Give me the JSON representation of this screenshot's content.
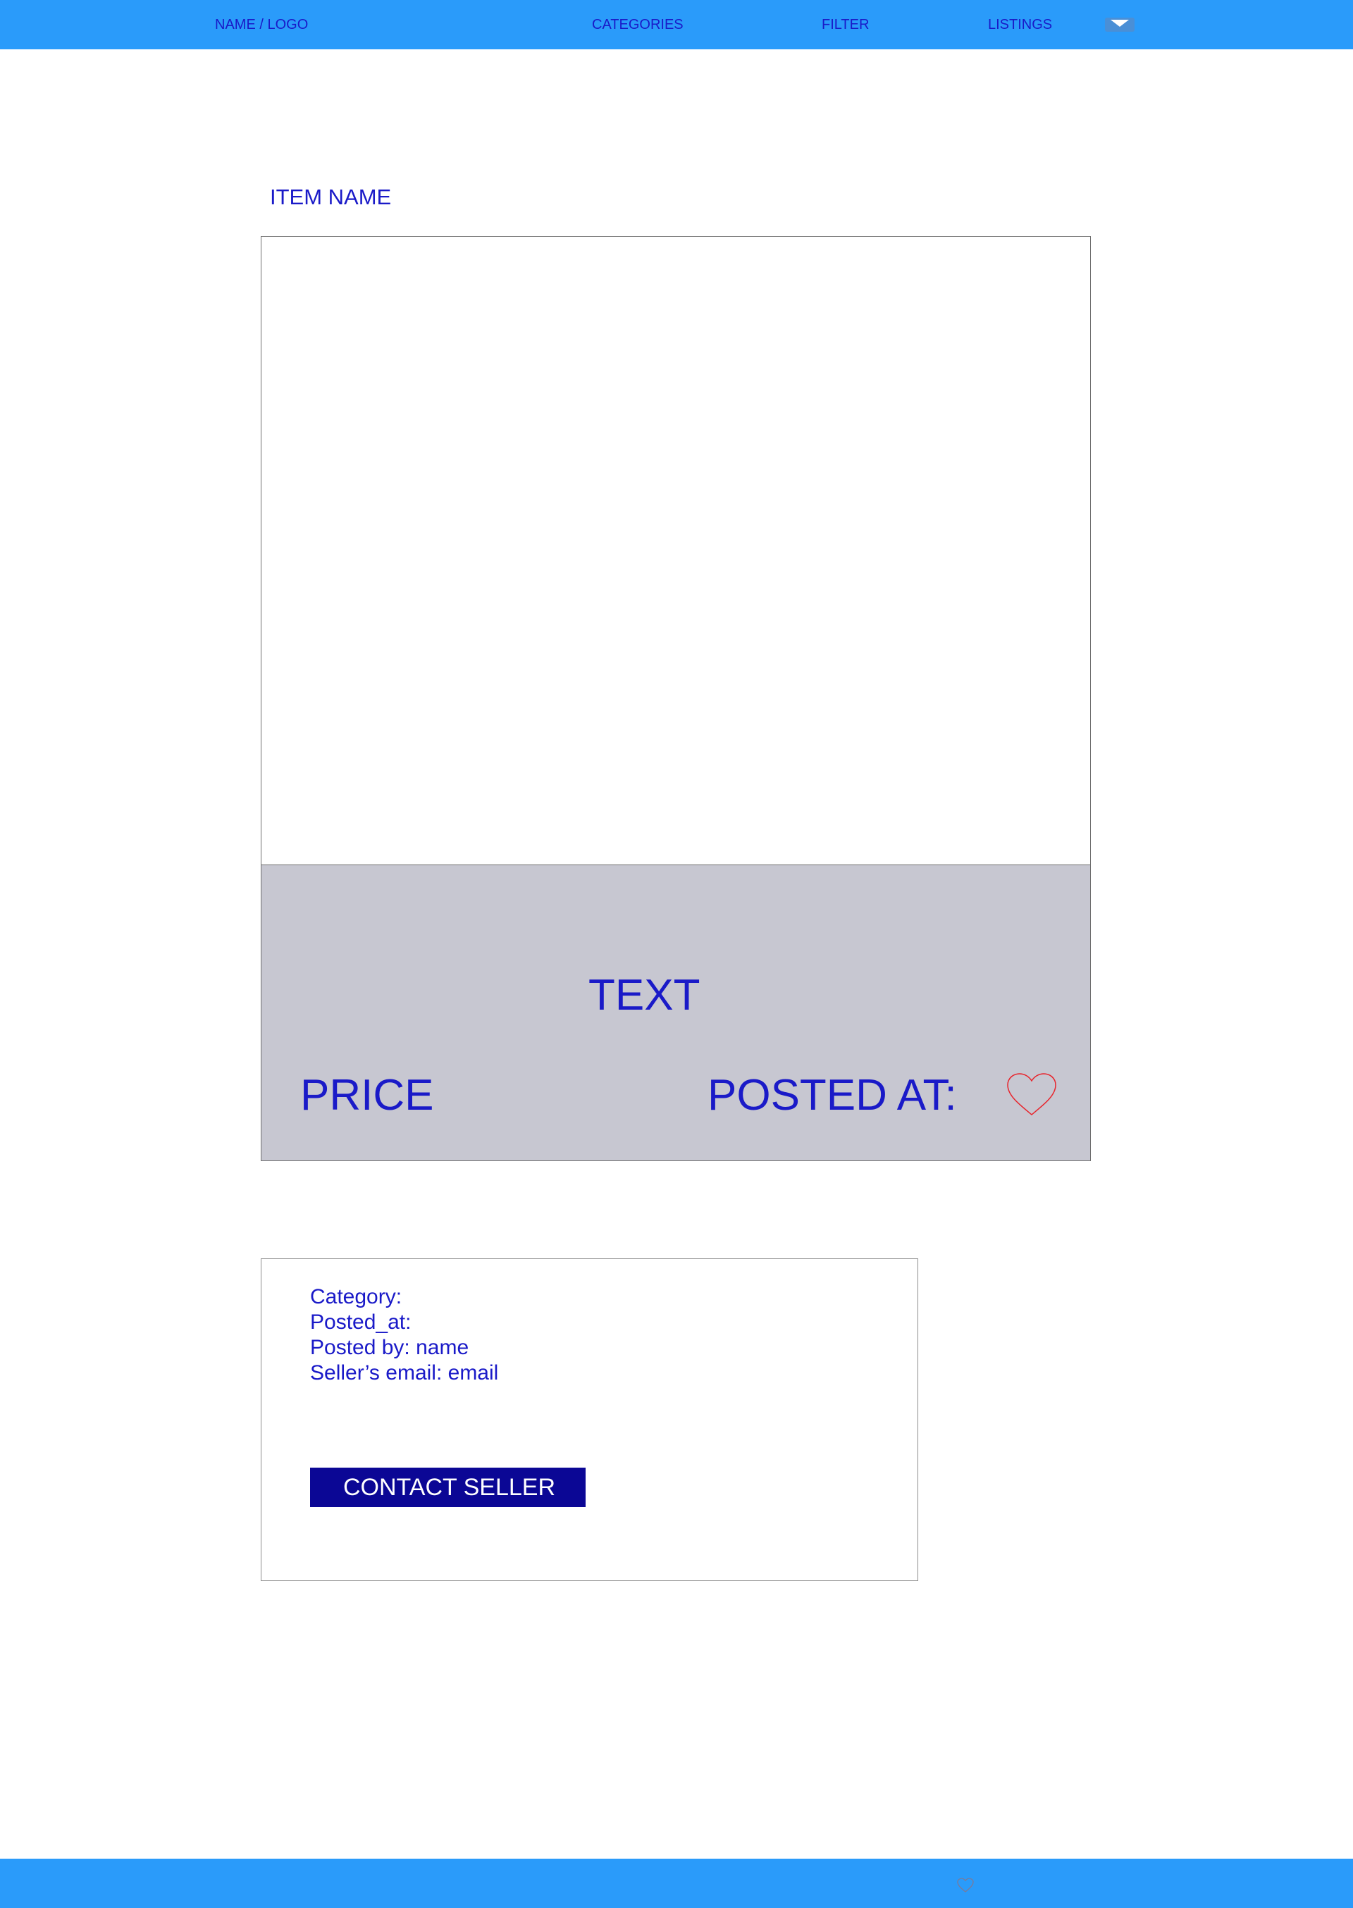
{
  "nav": {
    "logo": "NAME / LOGO",
    "categories": "CATEGORIES",
    "filter": "FILTER",
    "listings": "LISTINGS",
    "dropdown_icon": "chevron-down-icon"
  },
  "item": {
    "name": "ITEM NAME",
    "text": "TEXT",
    "price": "PRICE",
    "posted_at_label": "POSTED AT:",
    "favorite_icon": "heart-icon"
  },
  "details": {
    "category": "Category:",
    "posted_at": "Posted_at:",
    "posted_by": "Posted by: name",
    "seller_email": "Seller’s email: email",
    "contact_button": "CONTACT SELLER"
  },
  "footer": {
    "favorites_icon": "heart-icon"
  },
  "colors": {
    "bar": "#2a9bfa",
    "text": "#1a1ac8",
    "info_panel": "#c7c7d1",
    "button": "#0b0795",
    "heart": "#e8242c"
  }
}
